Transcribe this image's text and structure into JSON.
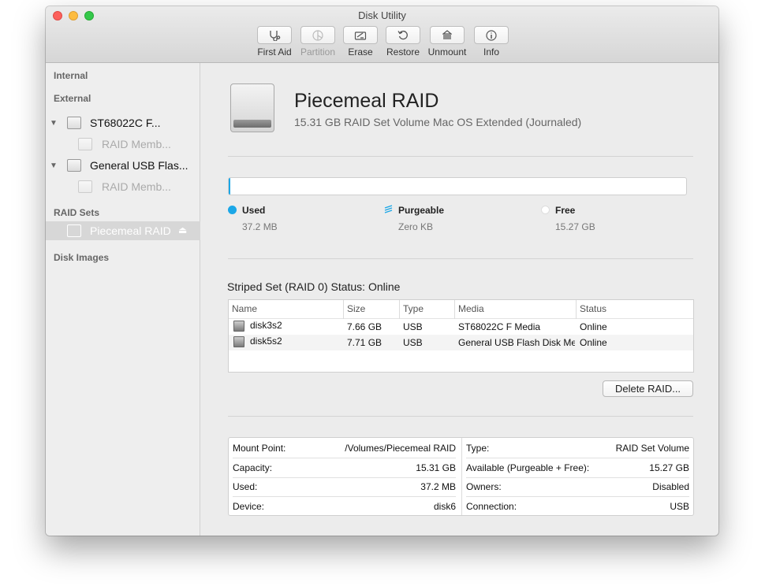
{
  "window": {
    "title": "Disk Utility"
  },
  "toolbar": {
    "buttons": [
      {
        "label": "First Aid",
        "icon": "stethoscope-icon",
        "enabled": true
      },
      {
        "label": "Partition",
        "icon": "partition-icon",
        "enabled": false
      },
      {
        "label": "Erase",
        "icon": "erase-icon",
        "enabled": true
      },
      {
        "label": "Restore",
        "icon": "restore-icon",
        "enabled": true
      },
      {
        "label": "Unmount",
        "icon": "unmount-icon",
        "enabled": true
      },
      {
        "label": "Info",
        "icon": "info-icon",
        "enabled": true
      }
    ]
  },
  "sidebar": {
    "sections": {
      "internal": "Internal",
      "external": "External",
      "raid_sets": "RAID Sets",
      "disk_images": "Disk Images"
    },
    "external_items": [
      {
        "label": "ST68022C F...",
        "child": "RAID Memb..."
      },
      {
        "label": "General USB Flas...",
        "child": "RAID Memb..."
      }
    ],
    "raid_item": {
      "label": "Piecemeal RAID"
    }
  },
  "volume": {
    "title": "Piecemeal RAID",
    "subtitle": "15.31 GB RAID Set Volume Mac OS Extended (Journaled)"
  },
  "usage": {
    "used_fraction": 0.0024,
    "colors": {
      "used": "#1ba7e7",
      "free": "#ffffff"
    },
    "used": {
      "label": "Used",
      "value": "37.2 MB"
    },
    "purgeable": {
      "label": "Purgeable",
      "value": "Zero KB"
    },
    "free": {
      "label": "Free",
      "value": "15.27 GB"
    }
  },
  "raid_status": "Striped Set (RAID 0) Status: Online",
  "members_table": {
    "headers": [
      "Name",
      "Size",
      "Type",
      "Media",
      "Status"
    ],
    "rows": [
      [
        "disk3s2",
        "7.66 GB",
        "USB",
        "ST68022C F Media",
        "Online"
      ],
      [
        "disk5s2",
        "7.71 GB",
        "USB",
        "General USB Flash Disk Me",
        "Online"
      ]
    ]
  },
  "delete_button": "Delete RAID...",
  "info": {
    "left": [
      {
        "key": "Mount Point:",
        "value": "/Volumes/Piecemeal RAID"
      },
      {
        "key": "Capacity:",
        "value": "15.31 GB"
      },
      {
        "key": "Used:",
        "value": "37.2 MB"
      },
      {
        "key": "Device:",
        "value": "disk6"
      }
    ],
    "right": [
      {
        "key": "Type:",
        "value": "RAID Set Volume"
      },
      {
        "key": "Available (Purgeable + Free):",
        "value": "15.27 GB"
      },
      {
        "key": "Owners:",
        "value": "Disabled"
      },
      {
        "key": "Connection:",
        "value": "USB"
      }
    ]
  }
}
